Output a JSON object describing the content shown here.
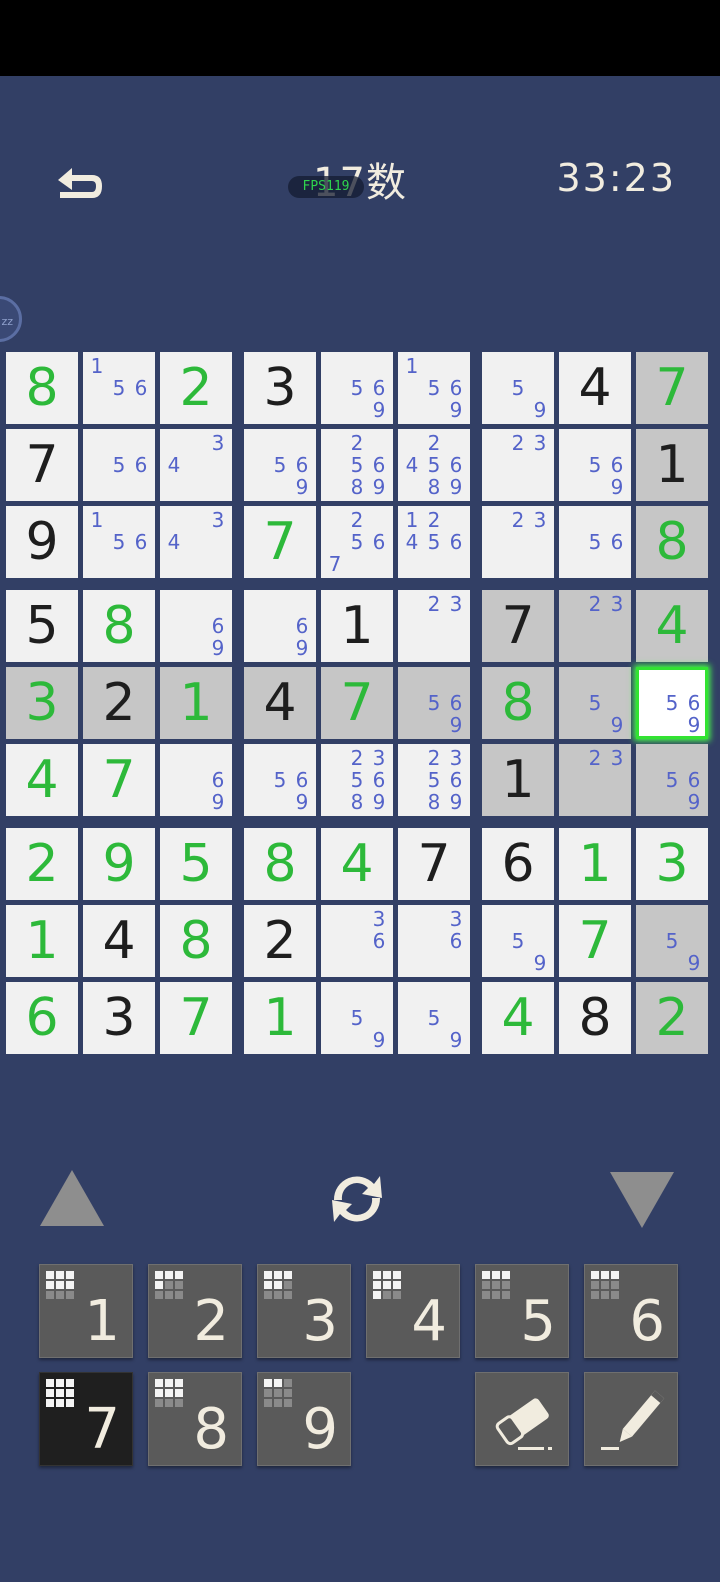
{
  "header": {
    "title": "17数",
    "fps": "FPS119",
    "timer": "33:23"
  },
  "sleep_badge": "zz",
  "colors": {
    "background": "#323f65",
    "cell": "#f1f1f1",
    "highlight": "#c6c6c6",
    "given": "#1e1e1e",
    "user": "#2db93a",
    "note": "#5463c9",
    "key": "#5a5a5a",
    "key_active": "#1f1f1f"
  },
  "board": {
    "selected": [
      4,
      8
    ],
    "highlighted": [
      [
        0,
        8
      ],
      [
        1,
        8
      ],
      [
        2,
        8
      ],
      [
        3,
        6
      ],
      [
        3,
        7
      ],
      [
        3,
        8
      ],
      [
        4,
        0
      ],
      [
        4,
        1
      ],
      [
        4,
        2
      ],
      [
        4,
        3
      ],
      [
        4,
        4
      ],
      [
        4,
        5
      ],
      [
        4,
        6
      ],
      [
        4,
        7
      ],
      [
        5,
        6
      ],
      [
        5,
        7
      ],
      [
        5,
        8
      ],
      [
        7,
        8
      ],
      [
        8,
        8
      ]
    ],
    "cells": [
      [
        {
          "v": "8",
          "t": "u"
        },
        {
          "n": "156"
        },
        {
          "v": "2",
          "t": "u"
        },
        {
          "v": "3",
          "t": "g"
        },
        {
          "n": "569"
        },
        {
          "n": "1569"
        },
        {
          "n": "59"
        },
        {
          "v": "4",
          "t": "g"
        },
        {
          "v": "7",
          "t": "u"
        }
      ],
      [
        {
          "v": "7",
          "t": "g"
        },
        {
          "n": "56"
        },
        {
          "n": "34"
        },
        {
          "n": "569"
        },
        {
          "n": "25689"
        },
        {
          "n": "245689"
        },
        {
          "n": "23"
        },
        {
          "n": "569"
        },
        {
          "v": "1",
          "t": "g"
        }
      ],
      [
        {
          "v": "9",
          "t": "g"
        },
        {
          "n": "156"
        },
        {
          "n": "34"
        },
        {
          "v": "7",
          "t": "u"
        },
        {
          "n": "2567"
        },
        {
          "n": "12456"
        },
        {
          "n": "23"
        },
        {
          "n": "56"
        },
        {
          "v": "8",
          "t": "u"
        }
      ],
      [
        {
          "v": "5",
          "t": "g"
        },
        {
          "v": "8",
          "t": "u"
        },
        {
          "n": "69"
        },
        {
          "n": "69"
        },
        {
          "v": "1",
          "t": "g"
        },
        {
          "n": "23"
        },
        {
          "v": "7",
          "t": "g"
        },
        {
          "n": "23"
        },
        {
          "v": "4",
          "t": "u"
        }
      ],
      [
        {
          "v": "3",
          "t": "u"
        },
        {
          "v": "2",
          "t": "g"
        },
        {
          "v": "1",
          "t": "u"
        },
        {
          "v": "4",
          "t": "g"
        },
        {
          "v": "7",
          "t": "u"
        },
        {
          "n": "569"
        },
        {
          "v": "8",
          "t": "u"
        },
        {
          "n": "59"
        },
        {
          "n": "569"
        }
      ],
      [
        {
          "v": "4",
          "t": "u"
        },
        {
          "v": "7",
          "t": "u"
        },
        {
          "n": "69"
        },
        {
          "n": "569"
        },
        {
          "n": "235689"
        },
        {
          "n": "235689"
        },
        {
          "v": "1",
          "t": "g"
        },
        {
          "n": "23"
        },
        {
          "n": "569"
        }
      ],
      [
        {
          "v": "2",
          "t": "u"
        },
        {
          "v": "9",
          "t": "u"
        },
        {
          "v": "5",
          "t": "u"
        },
        {
          "v": "8",
          "t": "u"
        },
        {
          "v": "4",
          "t": "u"
        },
        {
          "v": "7",
          "t": "g"
        },
        {
          "v": "6",
          "t": "g"
        },
        {
          "v": "1",
          "t": "u"
        },
        {
          "v": "3",
          "t": "u"
        }
      ],
      [
        {
          "v": "1",
          "t": "u"
        },
        {
          "v": "4",
          "t": "g"
        },
        {
          "v": "8",
          "t": "u"
        },
        {
          "v": "2",
          "t": "g"
        },
        {
          "n": "36"
        },
        {
          "n": "36"
        },
        {
          "n": "59"
        },
        {
          "v": "7",
          "t": "u"
        },
        {
          "n": "59"
        }
      ],
      [
        {
          "v": "6",
          "t": "u"
        },
        {
          "v": "3",
          "t": "g"
        },
        {
          "v": "7",
          "t": "u"
        },
        {
          "v": "1",
          "t": "u"
        },
        {
          "n": "59"
        },
        {
          "n": "59"
        },
        {
          "v": "4",
          "t": "u"
        },
        {
          "v": "8",
          "t": "g"
        },
        {
          "v": "2",
          "t": "u"
        }
      ]
    ]
  },
  "controls": {
    "prev": "triangle-up",
    "rotate": "rotate-icon",
    "next": "triangle-down"
  },
  "keypad": {
    "numbers": [
      {
        "label": "1",
        "filled": 6,
        "active": false
      },
      {
        "label": "2",
        "filled": 4,
        "active": false
      },
      {
        "label": "3",
        "filled": 5,
        "active": false
      },
      {
        "label": "4",
        "filled": 7,
        "active": false
      },
      {
        "label": "5",
        "filled": 3,
        "active": false
      },
      {
        "label": "6",
        "filled": 3,
        "active": false
      },
      {
        "label": "7",
        "filled": 9,
        "active": true
      },
      {
        "label": "8",
        "filled": 6,
        "active": false
      },
      {
        "label": "9",
        "filled": 2,
        "active": false
      }
    ],
    "tools": [
      "eraser-icon",
      "pencil-icon"
    ]
  }
}
